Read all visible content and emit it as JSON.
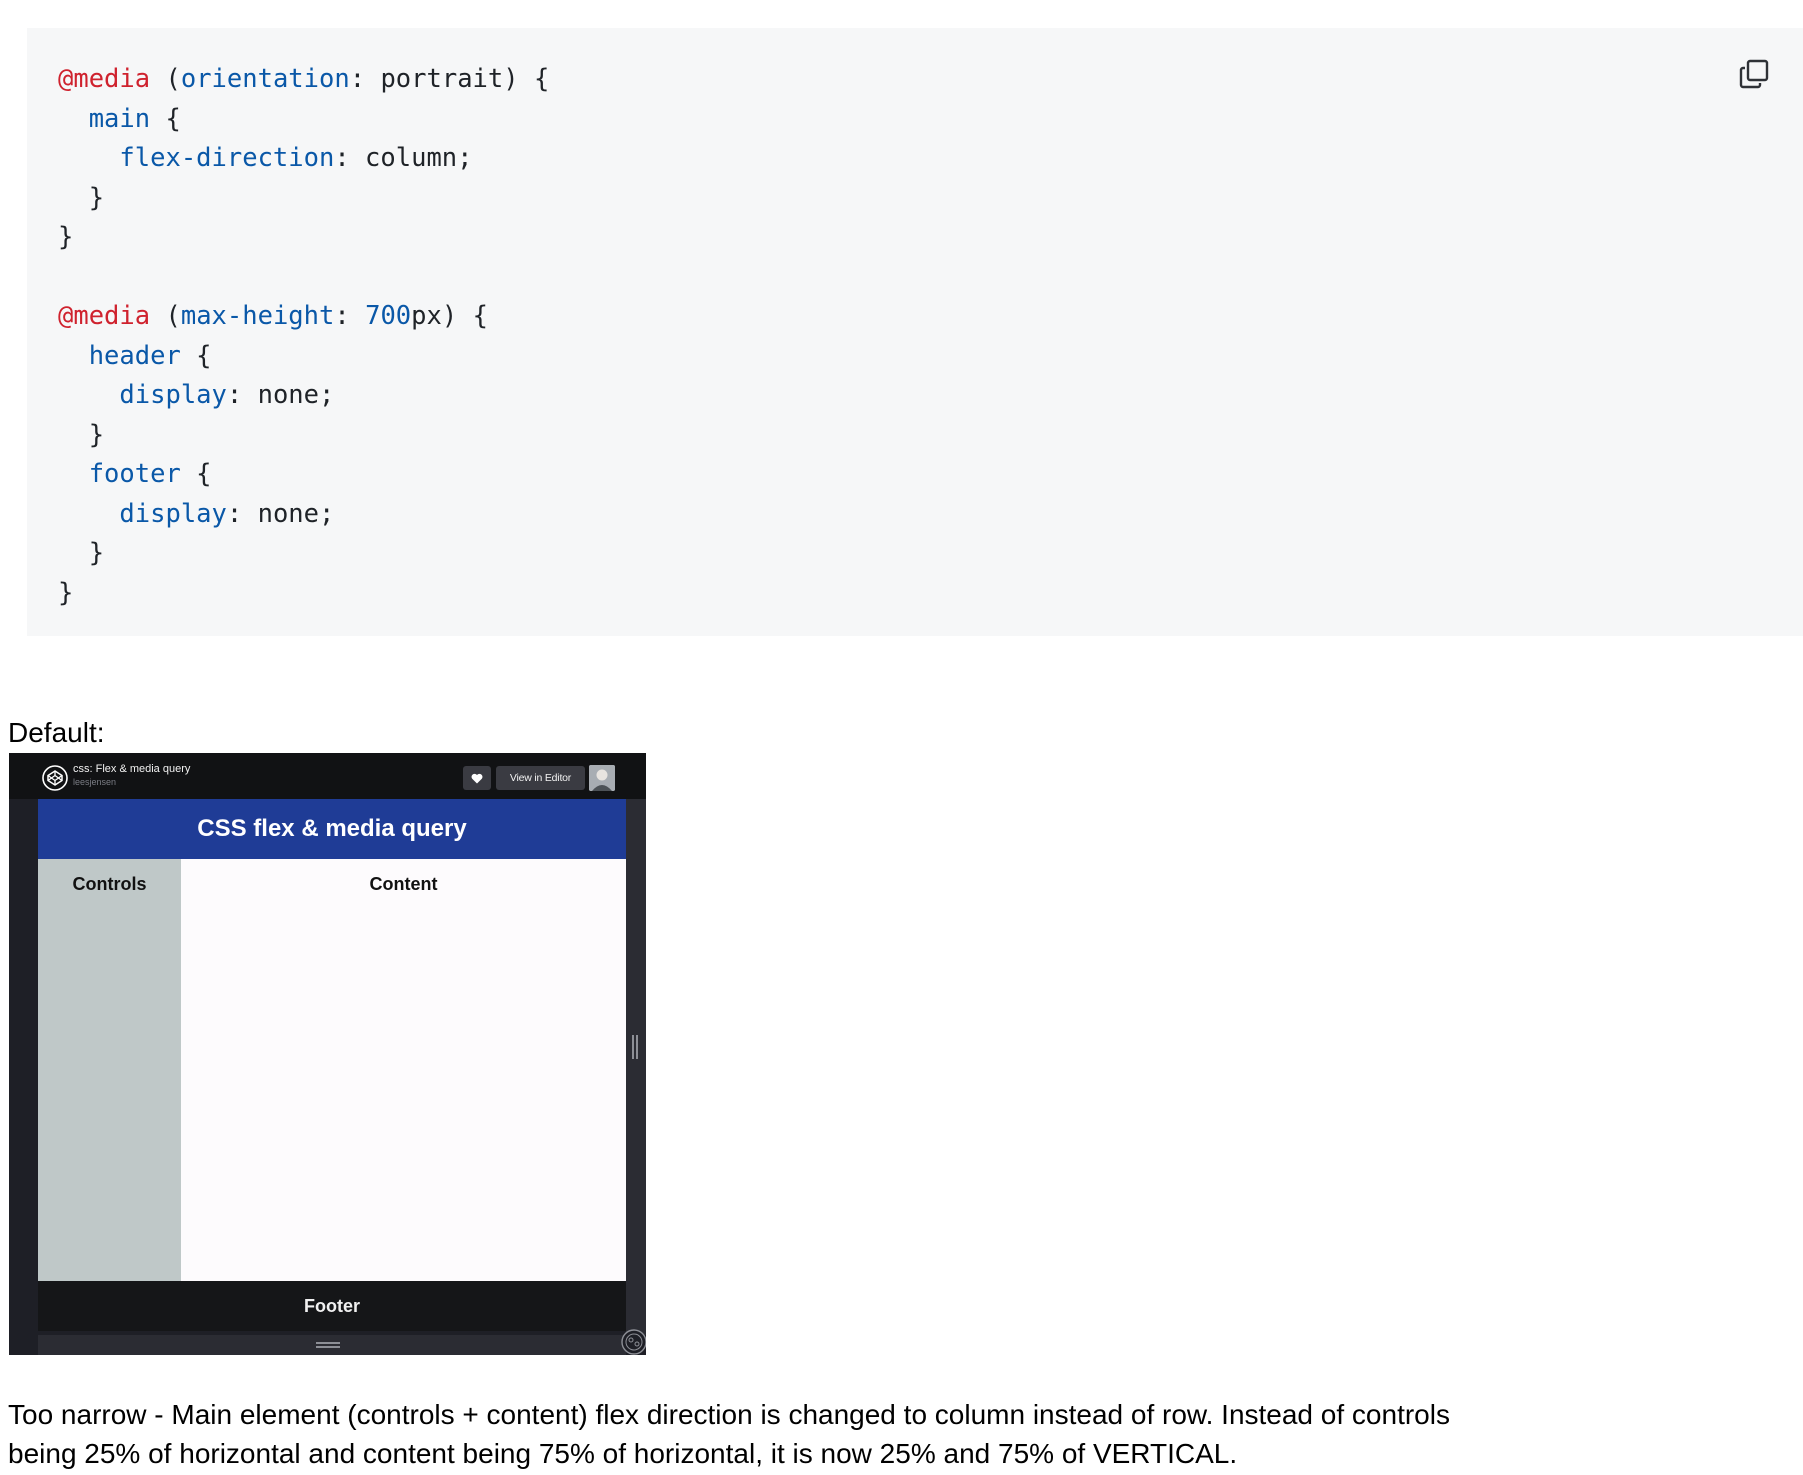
{
  "code_block": {
    "lines": [
      [
        {
          "t": "@media",
          "c": "at"
        },
        {
          "t": " (",
          "c": "pl"
        },
        {
          "t": "orientation",
          "c": "kw"
        },
        {
          "t": ": portrait) {",
          "c": "pl"
        }
      ],
      [
        {
          "t": "  main",
          "c": "kw"
        },
        {
          "t": " {",
          "c": "pl"
        }
      ],
      [
        {
          "t": "    flex-direction",
          "c": "kw"
        },
        {
          "t": ": column;",
          "c": "pl"
        }
      ],
      [
        {
          "t": "  }",
          "c": "pl"
        }
      ],
      [
        {
          "t": "}",
          "c": "pl"
        }
      ],
      [
        {
          "t": "",
          "c": "pl"
        }
      ],
      [
        {
          "t": "@media",
          "c": "at"
        },
        {
          "t": " (",
          "c": "pl"
        },
        {
          "t": "max-height",
          "c": "kw"
        },
        {
          "t": ": ",
          "c": "pl"
        },
        {
          "t": "700",
          "c": "num"
        },
        {
          "t": "px) {",
          "c": "pl"
        }
      ],
      [
        {
          "t": "  header",
          "c": "kw"
        },
        {
          "t": " {",
          "c": "pl"
        }
      ],
      [
        {
          "t": "    display",
          "c": "kw"
        },
        {
          "t": ": none;",
          "c": "pl"
        }
      ],
      [
        {
          "t": "  }",
          "c": "pl"
        }
      ],
      [
        {
          "t": "  footer",
          "c": "kw"
        },
        {
          "t": " {",
          "c": "pl"
        }
      ],
      [
        {
          "t": "    display",
          "c": "kw"
        },
        {
          "t": ": none;",
          "c": "pl"
        }
      ],
      [
        {
          "t": "  }",
          "c": "pl"
        }
      ],
      [
        {
          "t": "}",
          "c": "pl"
        }
      ]
    ],
    "copy_icon": "copy-icon"
  },
  "caption_default": "Default:",
  "screenshot": {
    "pen_title": "css: Flex & media query",
    "pen_author": "leesjensen",
    "heart_icon": "heart-icon",
    "view_in_editor": "View in Editor",
    "avatar_icon": "avatar",
    "demo_header": "CSS flex & media query",
    "demo_controls": "Controls",
    "demo_content": "Content",
    "demo_footer": "Footer"
  },
  "description": "Too narrow - Main element (controls + content) flex direction is changed to column instead of row. Instead of controls being 25% of horizontal and content being 75% of horizontal, it is now 25% and 75% of VERTICAL.",
  "colors": {
    "code_bg": "#f6f7f8",
    "at_rule": "#cf222e",
    "keyword": "#0a58a8",
    "plain": "#1f2328",
    "demo_header_bg": "#1f3c96",
    "demo_controls_bg": "#bfc8c8",
    "demo_content_bg": "#fdfbfd",
    "demo_footer_bg": "#151618"
  }
}
